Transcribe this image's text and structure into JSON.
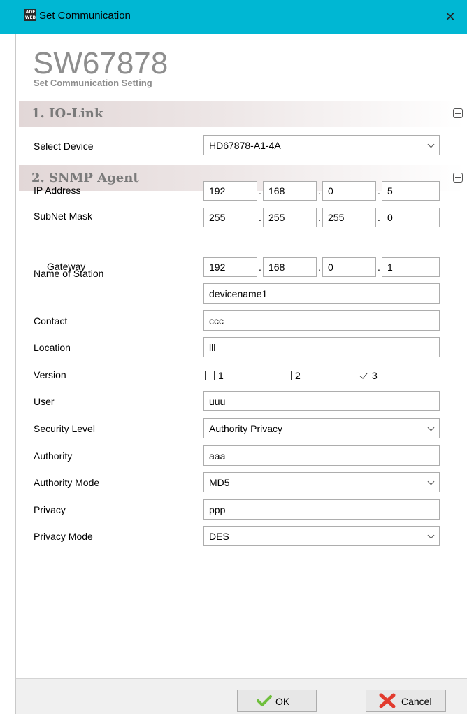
{
  "window": {
    "title": "Set Communication",
    "close_glyph": "✕"
  },
  "header": {
    "model": "SW67878",
    "subtitle": "Set Communication Setting"
  },
  "sections": {
    "io_link": {
      "title": "1. IO-Link"
    },
    "snmp": {
      "title": "2. SNMP Agent"
    }
  },
  "io_link": {
    "select_device_label": "Select Device",
    "select_device_value": "HD67878-A1-4A"
  },
  "snmp": {
    "ip_label": "IP Address",
    "ip": [
      "192",
      "168",
      "0",
      "5"
    ],
    "mask_label": "SubNet Mask",
    "mask": [
      "255",
      "255",
      "255",
      "0"
    ],
    "gateway_label": "Gateway",
    "gateway_checked": false,
    "gateway": [
      "192",
      "168",
      "0",
      "1"
    ],
    "station_label": "Name of Station",
    "station": "devicename1",
    "contact_label": "Contact",
    "contact": "ccc",
    "location_label": "Location",
    "location": "lll",
    "version_label": "Version",
    "versions": [
      {
        "label": "1",
        "checked": false
      },
      {
        "label": "2",
        "checked": false
      },
      {
        "label": "3",
        "checked": true
      }
    ],
    "user_label": "User",
    "user": "uuu",
    "security_label": "Security Level",
    "security": "Authority Privacy",
    "authority_label": "Authority",
    "authority": "aaa",
    "auth_mode_label": "Authority Mode",
    "auth_mode": "MD5",
    "privacy_label": "Privacy",
    "privacy": "ppp",
    "privacy_mode_label": "Privacy Mode",
    "privacy_mode": "DES"
  },
  "footer": {
    "ok_label": "OK",
    "cancel_label": "Cancel"
  },
  "icons": {
    "collapse": "collapse-icon",
    "ok": "check-icon",
    "cancel": "x-icon",
    "chevron": "chevron-down-icon"
  },
  "colors": {
    "titlebar": "#00b7d3",
    "ok_icon": "#6fbf3d",
    "cancel_icon": "#e23b2e"
  }
}
